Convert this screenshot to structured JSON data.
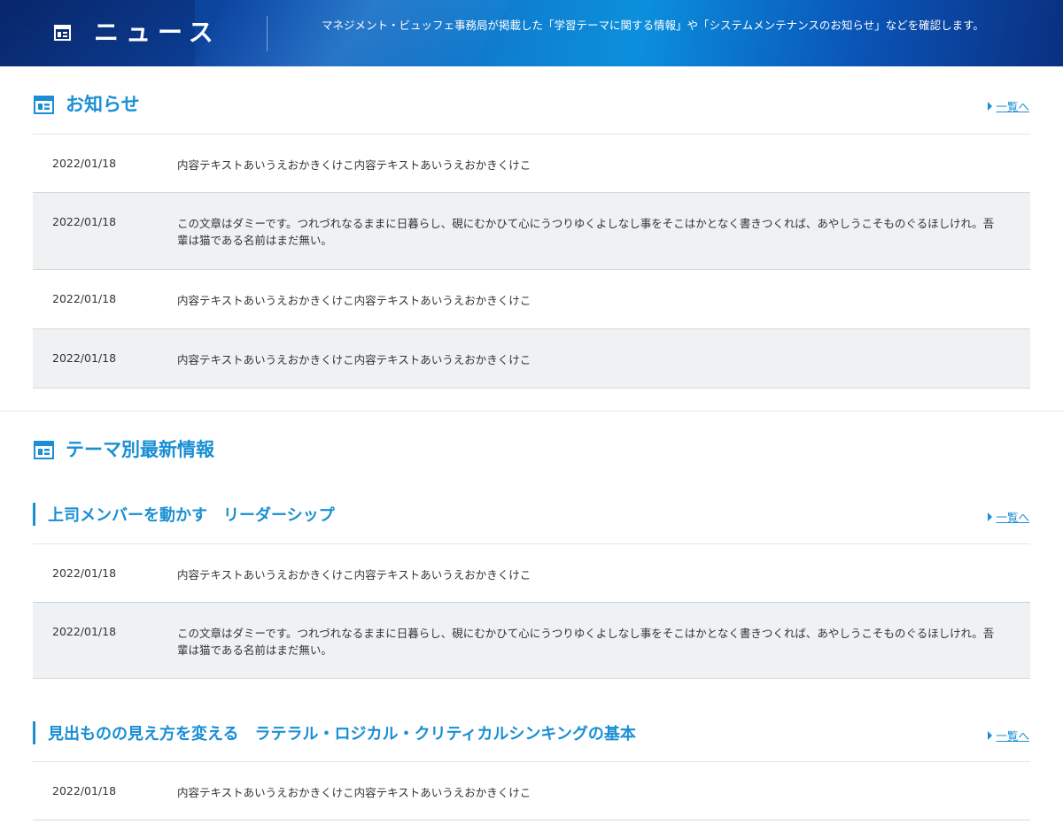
{
  "header": {
    "title": "ニュース",
    "description": "マネジメント・ビュッフェ事務局が掲載した「学習テーマに関する情報」や「システムメンテナンスのお知らせ」などを確認します。"
  },
  "notices": {
    "title": "お知らせ",
    "more_label": "一覧へ",
    "items": [
      {
        "date": "2022/01/18",
        "text": "内容テキストあいうえおかきくけこ内容テキストあいうえおかきくけこ"
      },
      {
        "date": "2022/01/18",
        "text": "この文章はダミーです。つれづれなるままに日暮らし、硯にむかひて心にうつりゆくよしなし事をそこはかとなく書きつくれば、あやしうこそものぐるほしけれ。吾輩は猫である名前はまだ無い。"
      },
      {
        "date": "2022/01/18",
        "text": "内容テキストあいうえおかきくけこ内容テキストあいうえおかきくけこ"
      },
      {
        "date": "2022/01/18",
        "text": "内容テキストあいうえおかきくけこ内容テキストあいうえおかきくけこ"
      }
    ]
  },
  "themes": {
    "title": "テーマ別最新情報",
    "groups": [
      {
        "title": "上司メンバーを動かす　リーダーシップ",
        "more_label": "一覧へ",
        "items": [
          {
            "date": "2022/01/18",
            "text": "内容テキストあいうえおかきくけこ内容テキストあいうえおかきくけこ"
          },
          {
            "date": "2022/01/18",
            "text": "この文章はダミーです。つれづれなるままに日暮らし、硯にむかひて心にうつりゆくよしなし事をそこはかとなく書きつくれば、あやしうこそものぐるほしけれ。吾輩は猫である名前はまだ無い。"
          }
        ]
      },
      {
        "title": "見出ものの見え方を変える　ラテラル・ロジカル・クリティカルシンキングの基本",
        "more_label": "一覧へ",
        "items": [
          {
            "date": "2022/01/18",
            "text": "内容テキストあいうえおかきくけこ内容テキストあいうえおかきくけこ"
          }
        ]
      }
    ]
  }
}
